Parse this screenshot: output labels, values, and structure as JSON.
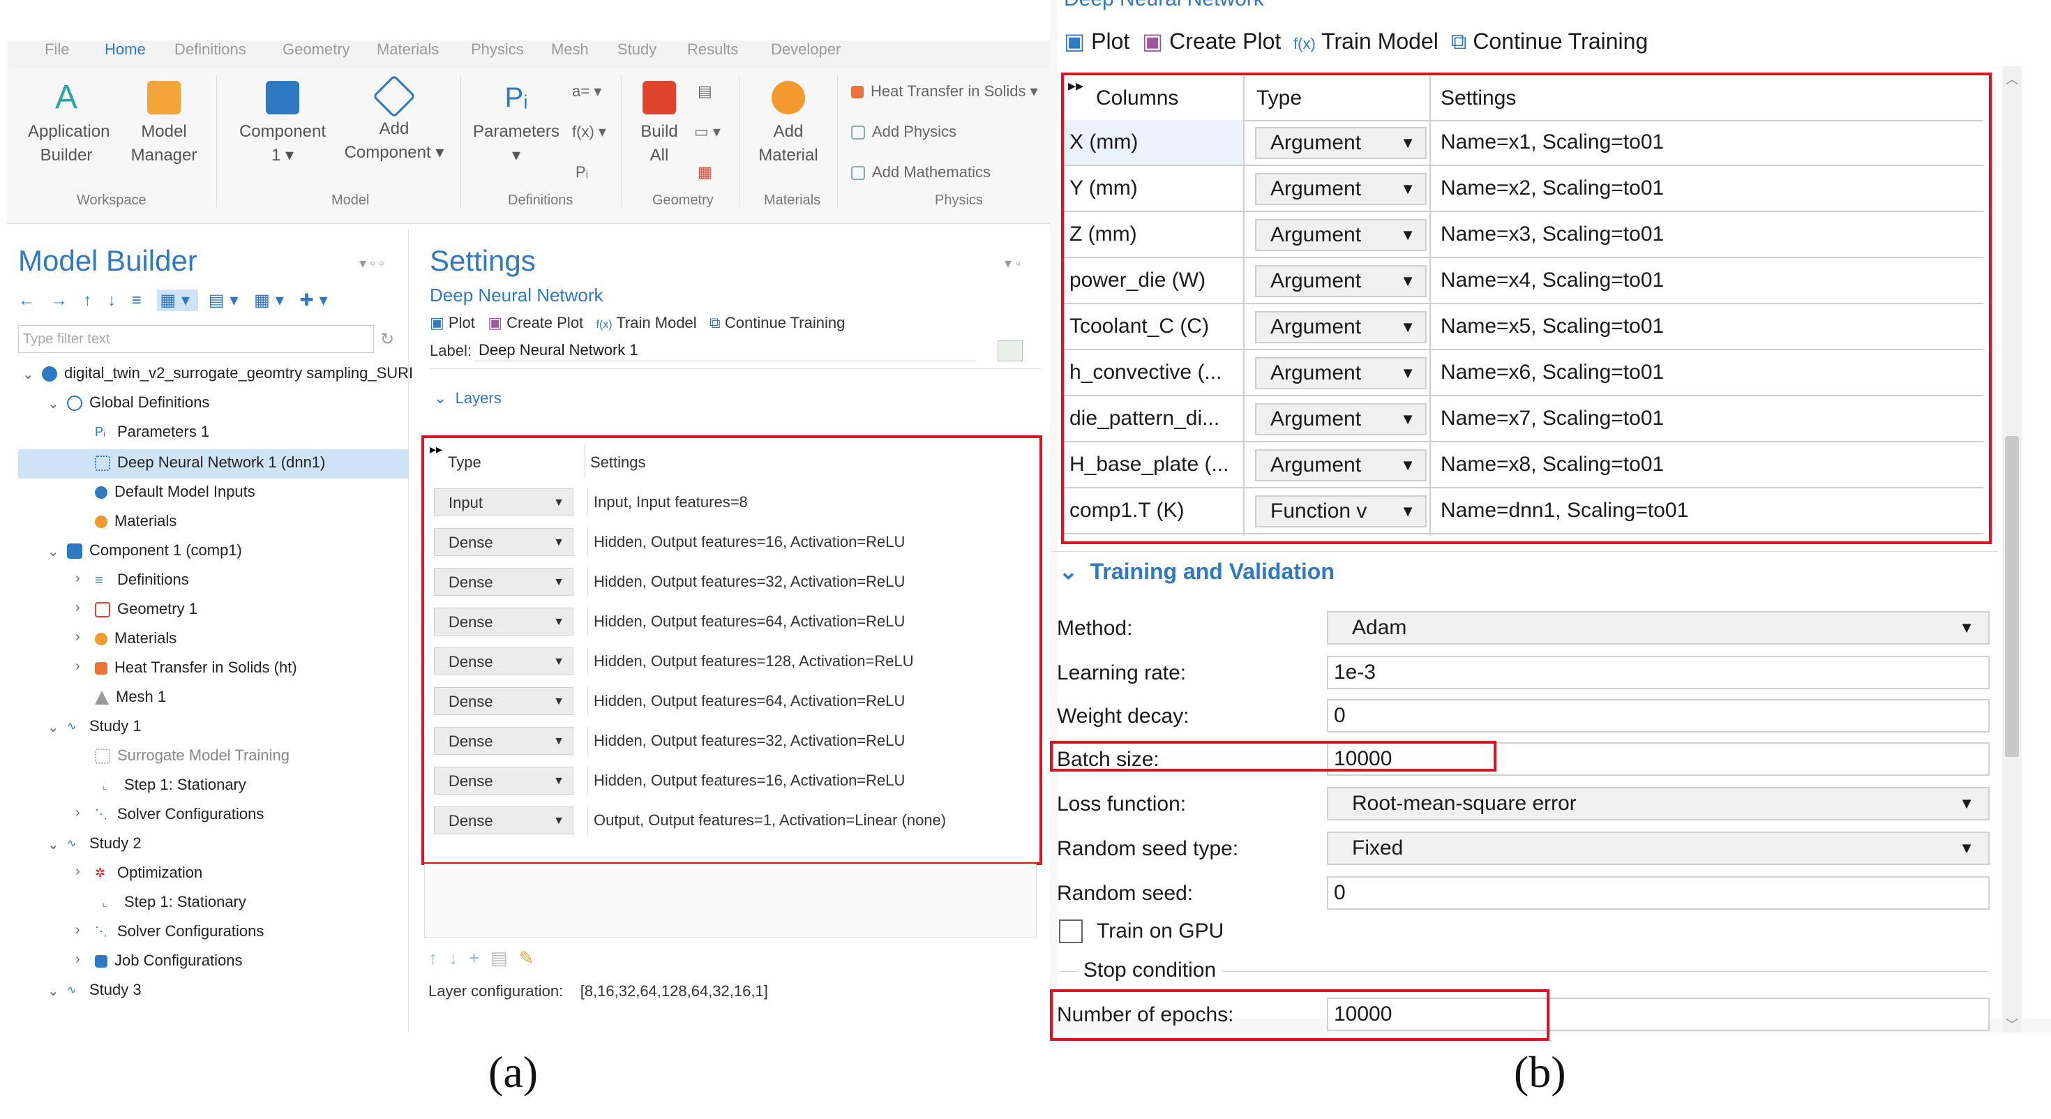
{
  "panel_a": {
    "ribbon": {
      "tabs": [
        "File",
        "Home",
        "Definitions",
        "Geometry",
        "Materials",
        "Physics",
        "Mesh",
        "Study",
        "Results",
        "Developer"
      ],
      "buttons": {
        "application_builder": "Application\nBuilder",
        "model_manager": "Model\nManager",
        "component": "Component\n1 ▾",
        "add_component": "Add\nComponent ▾",
        "parameters": "Parameters\n▾",
        "build_all": "Build\nAll",
        "add_material": "Add\nMaterial",
        "heat_transfer": "Heat Transfer in Solids ▾",
        "add_physics": "Add Physics",
        "add_mathematics": "Add Mathematics"
      },
      "groups": {
        "workspace": "Workspace",
        "model": "Model",
        "definitions": "Definitions",
        "geometry": "Geometry",
        "materials": "Materials",
        "physics": "Physics"
      }
    },
    "model_builder": {
      "title": "Model Builder",
      "filter_placeholder": "Type filter text",
      "tree": [
        "digital_twin_v2_surrogate_geomtry sampling_SURI",
        "Global Definitions",
        "Parameters 1",
        "Deep Neural Network 1 (dnn1)",
        "Default Model Inputs",
        "Materials",
        "Component 1 (comp1)",
        "Definitions",
        "Geometry 1",
        "Materials",
        "Heat Transfer in Solids (ht)",
        "Mesh 1",
        "Study 1",
        "Surrogate Model Training",
        "Step 1: Stationary",
        "Solver Configurations",
        "Study 2",
        "Optimization",
        "Step 1: Stationary",
        "Solver Configurations",
        "Job Configurations",
        "Study 3"
      ]
    },
    "settings": {
      "title": "Settings",
      "subtitle": "Deep Neural Network",
      "toolbar": [
        "Plot",
        "Create Plot",
        "Train Model",
        "Continue Training"
      ],
      "label_caption": "Label:",
      "label_value": "Deep Neural Network 1",
      "section": "Layers",
      "table_headers": [
        "Type",
        "Settings"
      ],
      "layers": [
        {
          "type": "Input",
          "settings": "Input, Input features=8"
        },
        {
          "type": "Dense",
          "settings": "Hidden, Output features=16, Activation=ReLU"
        },
        {
          "type": "Dense",
          "settings": "Hidden, Output features=32, Activation=ReLU"
        },
        {
          "type": "Dense",
          "settings": "Hidden, Output features=64, Activation=ReLU"
        },
        {
          "type": "Dense",
          "settings": "Hidden, Output features=128, Activation=ReLU"
        },
        {
          "type": "Dense",
          "settings": "Hidden, Output features=64, Activation=ReLU"
        },
        {
          "type": "Dense",
          "settings": "Hidden, Output features=32, Activation=ReLU"
        },
        {
          "type": "Dense",
          "settings": "Hidden, Output features=16, Activation=ReLU"
        },
        {
          "type": "Dense",
          "settings": "Output, Output features=1, Activation=Linear (none)"
        }
      ],
      "layer_config_label": "Layer configuration:",
      "layer_config_value": "[8,16,32,64,128,64,32,16,1]"
    },
    "caption": "(a)"
  },
  "panel_b": {
    "title_partial": "Deep Neural Network",
    "toolbar": [
      "Plot",
      "Create Plot",
      "Train Model",
      "Continue Training"
    ],
    "table_headers": [
      "Columns",
      "Type",
      "Settings"
    ],
    "rows": [
      {
        "column": "X (mm)",
        "type": "Argument",
        "settings": "Name=x1, Scaling=to01"
      },
      {
        "column": "Y (mm)",
        "type": "Argument",
        "settings": "Name=x2, Scaling=to01"
      },
      {
        "column": "Z (mm)",
        "type": "Argument",
        "settings": "Name=x3, Scaling=to01"
      },
      {
        "column": "power_die (W)",
        "type": "Argument",
        "settings": "Name=x4, Scaling=to01"
      },
      {
        "column": "Tcoolant_C (C)",
        "type": "Argument",
        "settings": "Name=x5, Scaling=to01"
      },
      {
        "column": "h_convective (...",
        "type": "Argument",
        "settings": "Name=x6, Scaling=to01"
      },
      {
        "column": "die_pattern_di...",
        "type": "Argument",
        "settings": "Name=x7, Scaling=to01"
      },
      {
        "column": "H_base_plate (...",
        "type": "Argument",
        "settings": "Name=x8, Scaling=to01"
      },
      {
        "column": "comp1.T (K)",
        "type": "Function v",
        "settings": "Name=dnn1, Scaling=to01"
      }
    ],
    "section": "Training and Validation",
    "form": {
      "method_label": "Method:",
      "method_value": "Adam",
      "lr_label": "Learning rate:",
      "lr_value": "1e-3",
      "wd_label": "Weight decay:",
      "wd_value": "0",
      "batch_label": "Batch size:",
      "batch_value": "10000",
      "loss_label": "Loss function:",
      "loss_value": "Root-mean-square error",
      "seed_type_label": "Random seed type:",
      "seed_type_value": "Fixed",
      "seed_label": "Random seed:",
      "seed_value": "0",
      "gpu_label": "Train on GPU",
      "stop_condition": "Stop condition",
      "epochs_label": "Number of epochs:",
      "epochs_value": "10000"
    },
    "caption": "(b)"
  },
  "colors": {
    "accent": "#2f79c2",
    "highlight": "#d9161f",
    "selection": "#cfe3f7"
  }
}
